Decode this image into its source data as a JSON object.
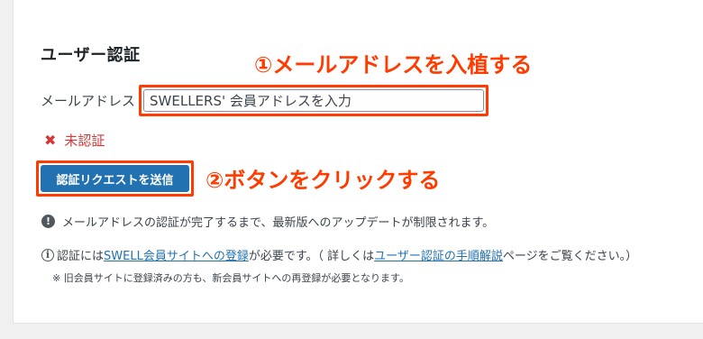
{
  "heading": "ユーザー認証",
  "annotations": {
    "step1": "①メールアドレスを入植する",
    "step2": "②ボタンをクリックする"
  },
  "email": {
    "label": "メールアドレス",
    "placeholder": "SWELLERS' 会員アドレスを入力",
    "value": ""
  },
  "status": {
    "icon": "x-icon",
    "text": "未認証"
  },
  "button": {
    "label": "認証リクエストを送信"
  },
  "notice": {
    "icon": "exclamation-icon",
    "text": "メールアドレスの認証が完了するまで、最新版へのアップデートが制限されます。"
  },
  "info": {
    "icon": "info-icon",
    "prefix": "認証には",
    "link1": "SWELL会員サイトへの登録",
    "middle": "が必要です。（ 詳しくは",
    "link2": "ユーザー認証の手順解説",
    "suffix": "ページをご覧ください。）"
  },
  "note": "※ 旧会員サイトに登録済みの方も、新会員サイトへの再登録が必要となります。",
  "colors": {
    "annotation": "#ff3b00",
    "button_bg": "#2271b1",
    "error": "#d63638",
    "link": "#2271b1"
  }
}
